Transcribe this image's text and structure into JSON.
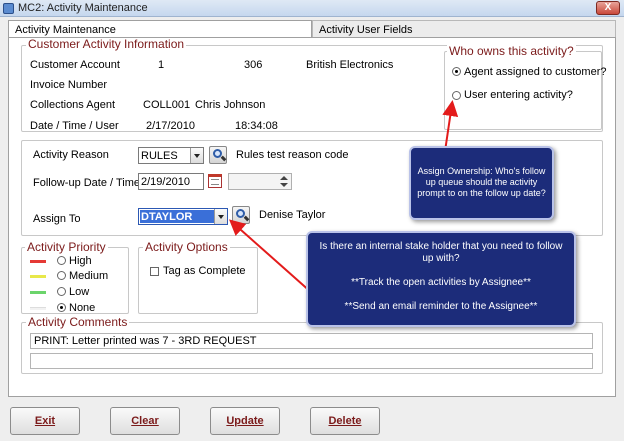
{
  "window": {
    "title": "MC2: Activity Maintenance",
    "close_label": "X"
  },
  "tabs": [
    {
      "label": "Activity Maintenance"
    },
    {
      "label": "Activity User Fields"
    }
  ],
  "customer_info": {
    "legend": "Customer Activity Information",
    "customer_account_label": "Customer Account",
    "customer_account_num": "1",
    "customer_code": "306",
    "customer_name": "British Electronics",
    "invoice_label": "Invoice Number",
    "collections_agent_label": "Collections Agent",
    "agent_code": "COLL001",
    "agent_name": "Chris Johnson",
    "datetime_label": "Date / Time / User",
    "date": "2/17/2010",
    "time": "18:34:08"
  },
  "ownership": {
    "legend": "Who owns this activity?",
    "options": [
      {
        "label": "Agent assigned to customer?",
        "selected": true
      },
      {
        "label": "User entering activity?",
        "selected": false
      }
    ]
  },
  "activity": {
    "reason_label": "Activity Reason",
    "reason_value": "RULES",
    "reason_desc": "Rules test reason code",
    "followup_label": "Follow-up Date / Time",
    "followup_date": "2/19/2010",
    "followup_time": "",
    "assign_label": "Assign To",
    "assign_value": "DTAYLOR",
    "assign_name": "Denise Taylor"
  },
  "priority": {
    "legend": "Activity Priority",
    "items": [
      {
        "label": "High",
        "color": "#e53935",
        "selected": false
      },
      {
        "label": "Medium",
        "color": "#e8e84a",
        "selected": false
      },
      {
        "label": "Low",
        "color": "#6bd46b",
        "selected": false
      },
      {
        "label": "None",
        "color": "#f2f2f2",
        "selected": true
      }
    ]
  },
  "options": {
    "legend": "Activity Options",
    "tag_complete_label": "Tag as Complete"
  },
  "comments": {
    "legend": "Activity Comments",
    "line1": "PRINT: Letter printed was 7 - 3RD REQUEST",
    "line2": ""
  },
  "buttons": {
    "exit": "Exit",
    "clear": "Clear",
    "update": "Update",
    "delete": "Delete"
  },
  "callouts": {
    "ownership": "Assign Ownership:  Who's follow up queue should the activity prompt to on the follow up date?",
    "assignee": "Is there an internal stake holder that you need to follow up with?\n\n**Track the open activities by Assignee**\n\n**Send an email reminder to the Assignee**"
  },
  "colors": {
    "legend_text": "#7b1a1a",
    "callout_bg": "#1c2c7a",
    "arrow": "#e31b1b",
    "selection": "#3a6fd8"
  }
}
